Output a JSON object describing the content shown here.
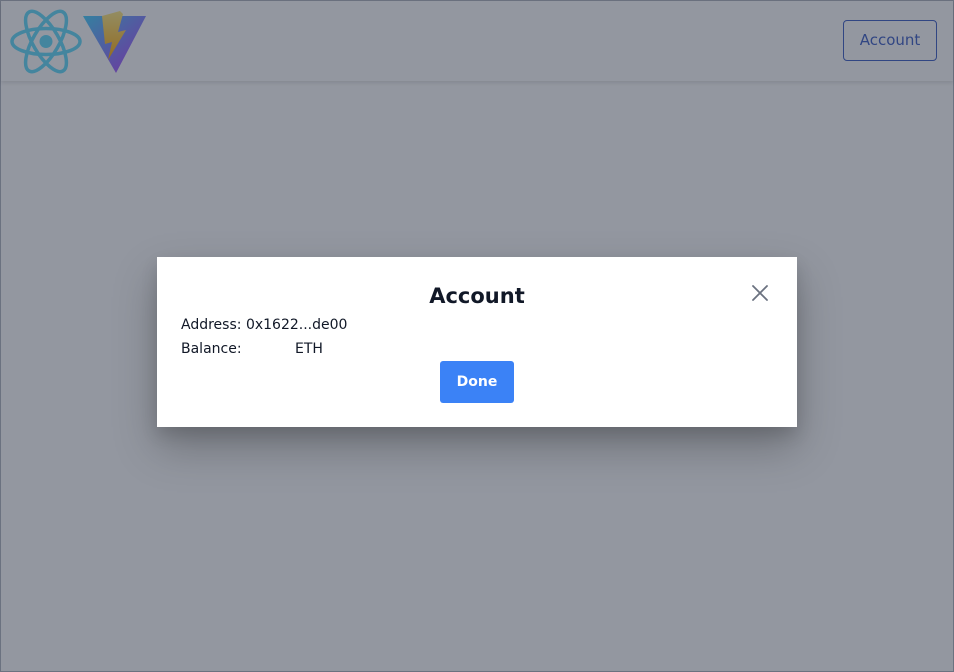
{
  "navbar": {
    "account_button_label": "Account",
    "logos": [
      "react-logo",
      "vite-logo"
    ]
  },
  "modal": {
    "title": "Account",
    "address_label": "Address:",
    "address_value": "0x1622...de00",
    "balance_label": "Balance:",
    "balance_unit": "ETH",
    "done_label": "Done",
    "close_icon": "close-icon"
  },
  "colors": {
    "primary": "#3b82f6",
    "account_border": "#3b5cc4",
    "react_blue": "#61dafb",
    "overlay": "#272f42"
  }
}
